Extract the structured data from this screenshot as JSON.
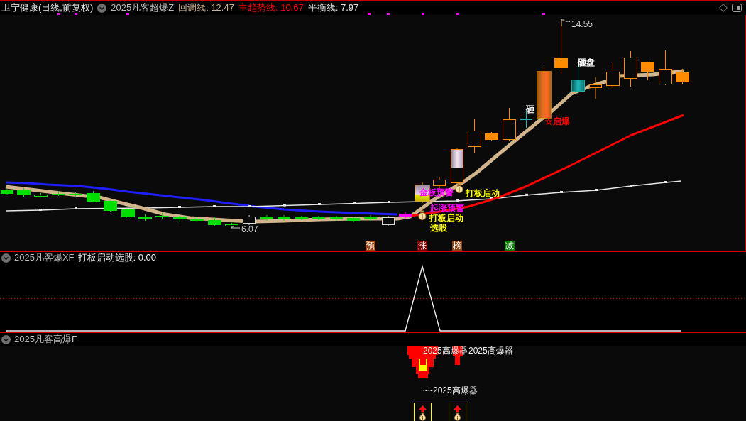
{
  "header": {
    "title": "卫宁健康(日线,前复权)",
    "indicator": "2025凡客超爆Z",
    "legend": [
      {
        "text": "回调线: 12.47",
        "color": "#d2b48c"
      },
      {
        "text": "主趋势线: 10.67",
        "color": "#ff0000"
      },
      {
        "text": "平衡线: 7.97",
        "color": "#e6e6e6"
      }
    ]
  },
  "main_chart": {
    "high_label": "14.55",
    "low_label": "6.07",
    "signals": [
      {
        "text": "砸盘",
        "color": "#ffffff"
      },
      {
        "text": "砸",
        "color": "#ffffff"
      },
      {
        "text": "☆启爆",
        "color": "#ff0000"
      },
      {
        "text": "金板预警",
        "color": "#ff00ff"
      },
      {
        "text": "打板启动",
        "color": "#ffff00"
      },
      {
        "text": "起涨预警",
        "color": "#ff00ff"
      },
      {
        "text": "打板启动",
        "color": "#ffff00"
      },
      {
        "text": "选股",
        "color": "#ffff00"
      }
    ],
    "tags": [
      {
        "text": "预",
        "color": "#a0400a"
      },
      {
        "text": "涨",
        "color": "#800000"
      },
      {
        "text": "榜",
        "color": "#8b4513"
      },
      {
        "text": "减",
        "color": "#008000"
      }
    ]
  },
  "xf_panel": {
    "indicator": "2025凡客爆XF",
    "reading": "打板启动选股: 0.00"
  },
  "f_panel": {
    "indicator": "2025凡客高爆F",
    "labels": [
      "2025高爆器",
      "2025高爆器",
      "~~2025高爆器"
    ]
  }
}
